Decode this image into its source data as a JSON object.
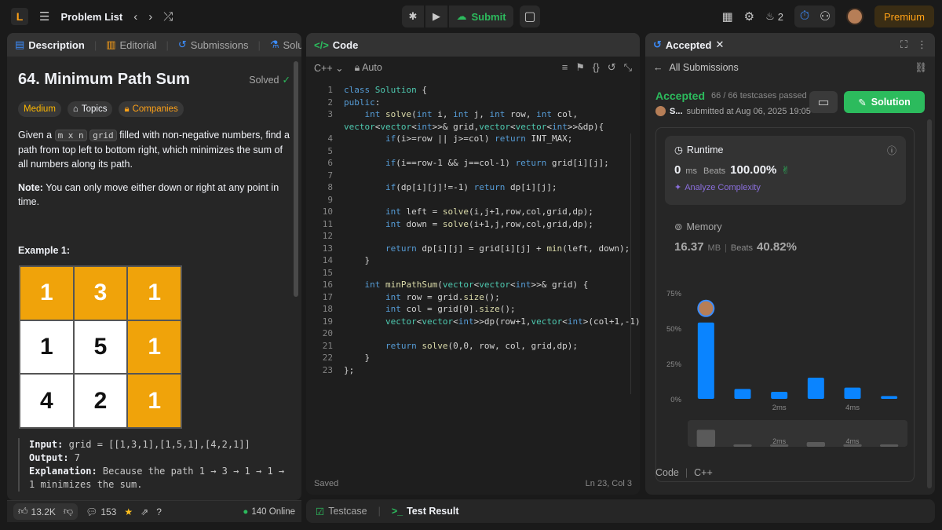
{
  "topbar": {
    "problem_list_label": "Problem List",
    "submit_label": "Submit",
    "streak_count": "2",
    "premium_label": "Premium"
  },
  "left": {
    "tabs": [
      {
        "label": "Description"
      },
      {
        "label": "Editorial"
      },
      {
        "label": "Submissions"
      },
      {
        "label": "Solutions"
      }
    ],
    "title": "64. Minimum Path Sum",
    "solved_label": "Solved",
    "tags": {
      "difficulty": "Medium",
      "topics": "Topics",
      "companies": "Companies"
    },
    "desc_pre": "Given a ",
    "desc_code1": "m x n",
    "desc_space": " ",
    "desc_code2": "grid",
    "desc_post": " filled with non-negative numbers, find a path from top left to bottom right, which minimizes the sum of all numbers along its path.",
    "note_bold": "Note:",
    "note_text": " You can only move either down or right at any point in time.",
    "example_title": "Example 1:",
    "grid": [
      {
        "v": "1",
        "c": "orange"
      },
      {
        "v": "3",
        "c": "orange"
      },
      {
        "v": "1",
        "c": "orange"
      },
      {
        "v": "1",
        "c": "white"
      },
      {
        "v": "5",
        "c": "white"
      },
      {
        "v": "1",
        "c": "orange"
      },
      {
        "v": "4",
        "c": "white"
      },
      {
        "v": "2",
        "c": "white"
      },
      {
        "v": "1",
        "c": "orange"
      }
    ],
    "input_label": "Input:",
    "input_value": " grid = [[1,3,1],[1,5,1],[4,2,1]]",
    "output_label": "Output:",
    "output_value": " 7",
    "explanation_label": "Explanation:",
    "explanation_value": " Because the path 1 → 3 → 1 → 1 → 1 minimizes the sum.",
    "footer": {
      "likes": "13.2K",
      "comments": "153",
      "online": "140 Online"
    }
  },
  "code": {
    "tab_label": "Code",
    "language": "C++",
    "auto_label": "Auto",
    "lines": [
      "class Solution {",
      "public:",
      "    int solve(int i, int j, int row, int col,",
      "        if(i>=row || j>=col) return INT_MAX;",
      "",
      "        if(i==row-1 && j==col-1) return grid[i][j];",
      "",
      "        if(dp[i][j]!=-1) return dp[i][j];",
      "",
      "        int left = solve(i,j+1,row,col,grid,dp);",
      "        int down = solve(i+1,j,row,col,grid,dp);",
      "",
      "        return dp[i][j] = grid[i][j] + min(left, down);",
      "    }",
      "",
      "    int minPathSum(vector<vector<int>>& grid) {",
      "        int row = grid.size();",
      "        int col = grid[0].size();",
      "        vector<vector<int>>dp(row+1,vector<int>(col+1,-1));",
      "",
      "        return solve(0,0, row, col, grid,dp);",
      "    }",
      "};"
    ],
    "wrap_line": "vector<vector<int>>& grid,vector<vector<int>>&dp){",
    "status_saved": "Saved",
    "status_pos": "Ln 23, Col 3"
  },
  "tests": {
    "testcase_label": "Testcase",
    "result_label": "Test Result"
  },
  "right": {
    "tab_label": "Accepted",
    "all_submissions": "All Submissions",
    "status": "Accepted",
    "testcases": "66 / 66 testcases passed",
    "user": "S...",
    "submitted_at": "submitted at Aug 06, 2025 19:05",
    "solution_btn": "Solution",
    "runtime_label": "Runtime",
    "runtime_value": "0",
    "runtime_unit": "ms",
    "beats_label": "Beats",
    "runtime_beats": "100.00%",
    "analyze": "Analyze Complexity",
    "memory_label": "Memory",
    "memory_value": "16.37",
    "memory_unit": "MB",
    "memory_beats": "40.82%",
    "code_label": "Code",
    "code_lang": "C++"
  },
  "chart_data": {
    "type": "bar",
    "y_ticks": [
      "75%",
      "50%",
      "25%",
      "0%"
    ],
    "ylim": [
      0,
      75
    ],
    "x_tick_labels": [
      "2ms",
      "4ms"
    ],
    "values": [
      54,
      7,
      5,
      15,
      8,
      2
    ],
    "highlight_index": 0,
    "bar_color": "#0a84ff"
  }
}
